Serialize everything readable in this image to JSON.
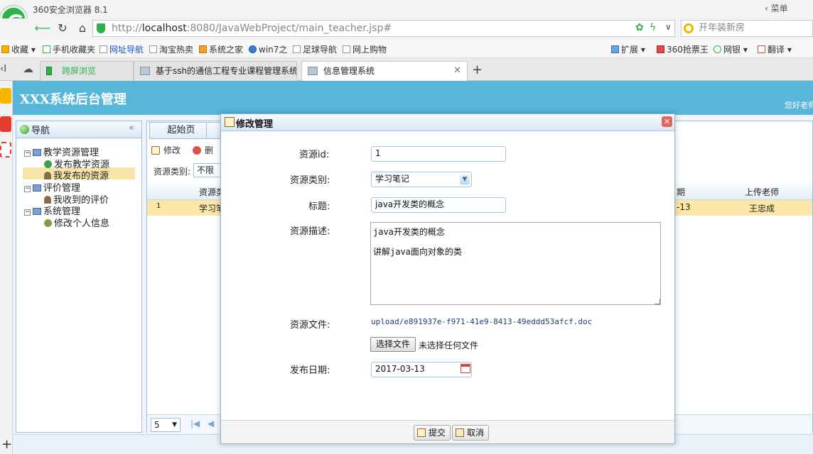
{
  "browser": {
    "name": "360安全浏览器 8.1",
    "menu": "菜单",
    "url_scheme": "http://",
    "url_host": "localhost",
    "url_rest": ":8080/JavaWebProject/main_teacher.jsp#",
    "search_placeholder": "开年装新房",
    "bookmarks_left": [
      "收藏",
      "手机收藏夹",
      "网址导航",
      "淘宝热卖",
      "系统之家",
      "win7之",
      "足球导航",
      "网上购物"
    ],
    "bookmarks_right": [
      "扩展",
      "360抢票王",
      "网银",
      "翻译"
    ],
    "tabs": [
      "跨屏浏览",
      "基于ssh的通信工程专业课程管理系统",
      "信息管理系统"
    ]
  },
  "app": {
    "title": "XXX系统后台管理",
    "greeting": "您好老师",
    "nav": {
      "title": "导航",
      "tree": [
        {
          "label": "教学资源管理",
          "children": [
            "发布教学资源",
            "我发布的资源"
          ]
        },
        {
          "label": "评价管理",
          "children": [
            "我收到的评价"
          ]
        },
        {
          "label": "系统管理",
          "children": [
            "修改个人信息"
          ]
        }
      ]
    },
    "grid": {
      "tab": "起始页",
      "toolbar": [
        "修改",
        "删除"
      ],
      "filter_label": "资源类别:",
      "filter_value": "不限制",
      "header_type": "资源类",
      "header_date": "期",
      "header_teacher": "上传老师",
      "row": {
        "num": "1",
        "type": "学习笔",
        "date": "-13",
        "teacher": "王忠成"
      },
      "page_size": "5"
    }
  },
  "modal": {
    "title": "修改管理",
    "labels": {
      "id": "资源id:",
      "type": "资源类别:",
      "title": "标题:",
      "desc": "资源描述:",
      "file": "资源文件:",
      "date": "发布日期:"
    },
    "values": {
      "id": "1",
      "type": "学习笔记",
      "title": "java开发类的概念",
      "desc_line1": "java开发类的概念",
      "desc_line2": "讲解java面向对象的类",
      "file_path": "upload/e891937e-f971-41e9-8413-49eddd53afcf.doc",
      "choose_file": "选择文件",
      "no_file": "未选择任何文件",
      "date": "2017-03-13"
    },
    "buttons": {
      "submit": "提交",
      "cancel": "取消"
    }
  }
}
